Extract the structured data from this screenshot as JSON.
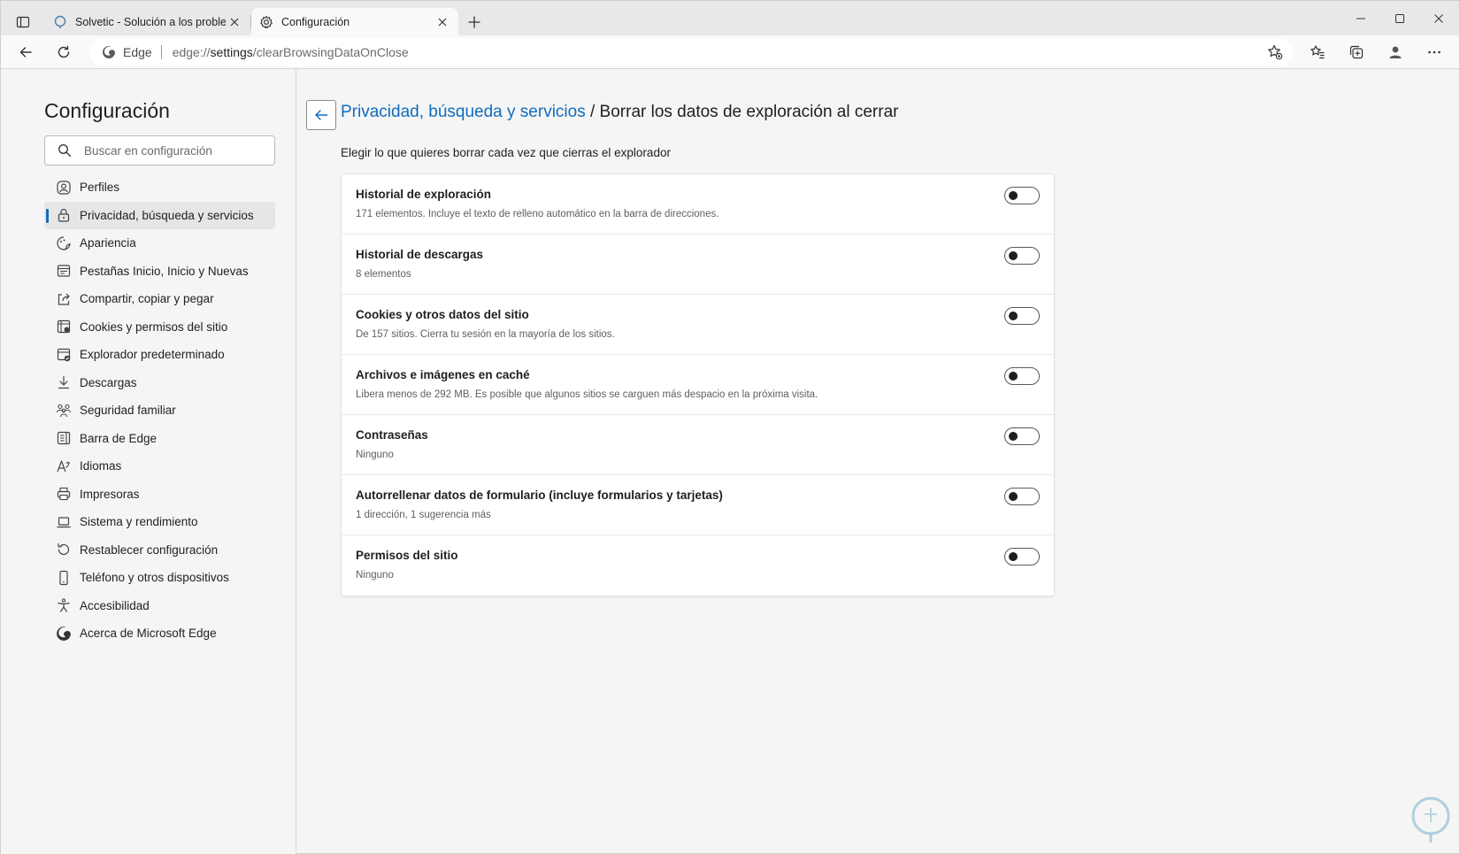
{
  "window": {
    "tabs": [
      {
        "label": "Solvetic - Solución a los problemas",
        "icon": "solvetic-favicon",
        "active": false
      },
      {
        "label": "Configuración",
        "icon": "gear-icon",
        "active": true
      }
    ]
  },
  "toolbar": {
    "site_label": "Edge",
    "url_prefix": "edge://",
    "url_host": "settings",
    "url_path": "/clearBrowsingDataOnClose"
  },
  "sidebar": {
    "title": "Configuración",
    "search_placeholder": "Buscar en configuración",
    "items": [
      {
        "label": "Perfiles",
        "icon": "profile-icon"
      },
      {
        "label": "Privacidad, búsqueda y servicios",
        "icon": "lock-icon",
        "selected": true
      },
      {
        "label": "Apariencia",
        "icon": "appearance-icon"
      },
      {
        "label": "Pestañas Inicio, Inicio y Nuevas",
        "icon": "tabs-icon"
      },
      {
        "label": "Compartir, copiar y pegar",
        "icon": "share-icon"
      },
      {
        "label": "Cookies y permisos del sitio",
        "icon": "cookies-icon"
      },
      {
        "label": "Explorador predeterminado",
        "icon": "default-browser-icon"
      },
      {
        "label": "Descargas",
        "icon": "download-icon"
      },
      {
        "label": "Seguridad familiar",
        "icon": "family-icon"
      },
      {
        "label": "Barra de Edge",
        "icon": "edge-bar-icon"
      },
      {
        "label": "Idiomas",
        "icon": "language-icon"
      },
      {
        "label": "Impresoras",
        "icon": "printer-icon"
      },
      {
        "label": "Sistema y rendimiento",
        "icon": "laptop-icon"
      },
      {
        "label": "Restablecer configuración",
        "icon": "reset-icon"
      },
      {
        "label": "Teléfono y otros dispositivos",
        "icon": "phone-icon"
      },
      {
        "label": "Accesibilidad",
        "icon": "accessibility-icon"
      },
      {
        "label": "Acerca de Microsoft Edge",
        "icon": "edge-logo-icon"
      }
    ]
  },
  "main": {
    "breadcrumb_parent": "Privacidad, búsqueda y servicios",
    "breadcrumb_separator": "/",
    "page_title": "Borrar los datos de exploración al cerrar",
    "subtitle": "Elegir lo que quieres borrar cada vez que cierras el explorador",
    "options": [
      {
        "title": "Historial de exploración",
        "desc": "171 elementos. Incluye el texto de relleno automático en la barra de direcciones.",
        "enabled": false
      },
      {
        "title": "Historial de descargas",
        "desc": "8 elementos",
        "enabled": false
      },
      {
        "title": "Cookies y otros datos del sitio",
        "desc": "De 157 sitios. Cierra tu sesión en la mayoría de los sitios.",
        "enabled": false
      },
      {
        "title": "Archivos e imágenes en caché",
        "desc": "Libera menos de 292 MB. Es posible que algunos sitios se carguen más despacio en la próxima visita.",
        "enabled": false
      },
      {
        "title": "Contraseñas",
        "desc": "Ninguno",
        "enabled": false
      },
      {
        "title": "Autorrellenar datos de formulario (incluye formularios y tarjetas)",
        "desc": "1 dirección, 1 sugerencia más",
        "enabled": false
      },
      {
        "title": "Permisos del sitio",
        "desc": "Ninguno",
        "enabled": false
      }
    ]
  },
  "colors": {
    "accent": "#0f6cbd",
    "sidebar_bg": "#f5f5f5",
    "tabstrip_bg": "#e8e8e8"
  }
}
